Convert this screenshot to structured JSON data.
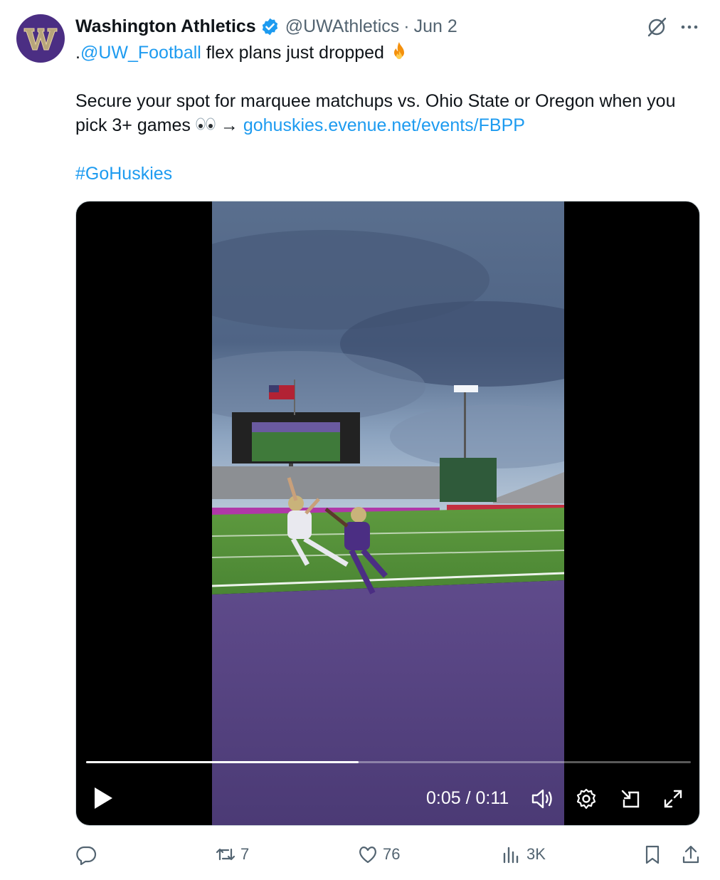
{
  "author": {
    "display_name": "Washington Athletics",
    "handle": "@UWAthletics",
    "separator": "·",
    "date": "Jun 2",
    "avatar_icon": "husky-w-logo",
    "verified_icon": "verified-badge-icon"
  },
  "tweet": {
    "line1_prefix": ".",
    "line1_mention": "@UW_Football",
    "line1_rest": " flex plans just dropped",
    "line2": "Secure your spot for marquee matchups vs. Ohio State or Oregon when you",
    "line3_prefix": "pick 3+ games",
    "line3_arrow": "→ ",
    "line3_link": "gohuskies.evenue.net/events/FBPP",
    "hashtag": "#GoHuskies"
  },
  "video": {
    "current_time": "0:05",
    "time_separator": " / ",
    "duration": "0:11",
    "progress_fraction": 0.45,
    "controls": [
      "play-icon",
      "volume-icon",
      "settings-gear-icon",
      "pip-icon",
      "fullscreen-icon"
    ]
  },
  "actions": {
    "reply_count": "",
    "retweet_count": "7",
    "like_count": "76",
    "views_count": "3K"
  },
  "colors": {
    "link": "#1d9bf0",
    "secondary": "#536471",
    "verified": "#1d9bf0",
    "uw_purple": "#4b2e83"
  }
}
